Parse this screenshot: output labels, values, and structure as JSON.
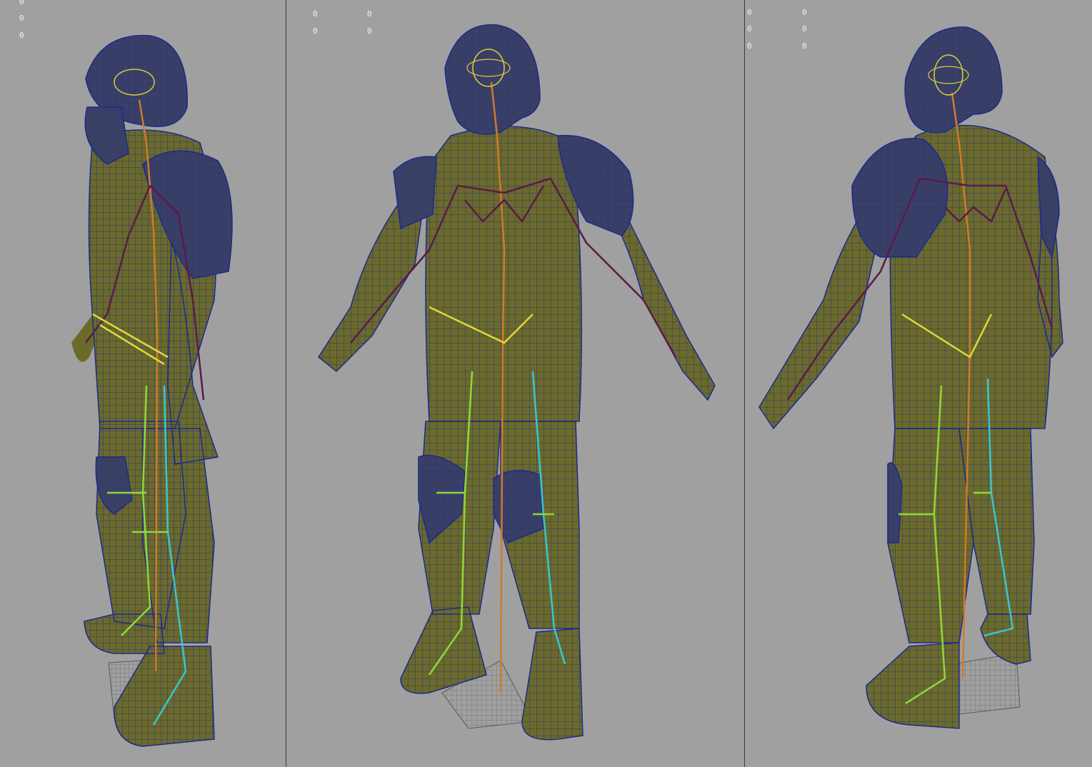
{
  "viewports": [
    {
      "name": "left",
      "hud": {
        "col_a": [
          "0",
          "0",
          "0"
        ]
      }
    },
    {
      "name": "center",
      "hud": {
        "col_a": [
          "0",
          "0"
        ],
        "col_b": [
          "0",
          "0"
        ]
      }
    },
    {
      "name": "right",
      "hud": {
        "col_a": [
          "0",
          "0",
          "0"
        ],
        "col_b": [
          "0",
          "0",
          "0"
        ]
      }
    }
  ],
  "colors": {
    "background": "#a0a0a0",
    "mesh_fill": "#6b6a2a",
    "wire": "#1c2a8a",
    "armor": "#3a3f66",
    "spine_joint": "#d07a2a",
    "arm_joint": "#5a1a4a",
    "leg_joint_top": "#8fd83a",
    "leg_joint_bottom": "#3ac6d0",
    "hip_joint": "#e0d83a",
    "head_joint": "#d6cf3a"
  }
}
